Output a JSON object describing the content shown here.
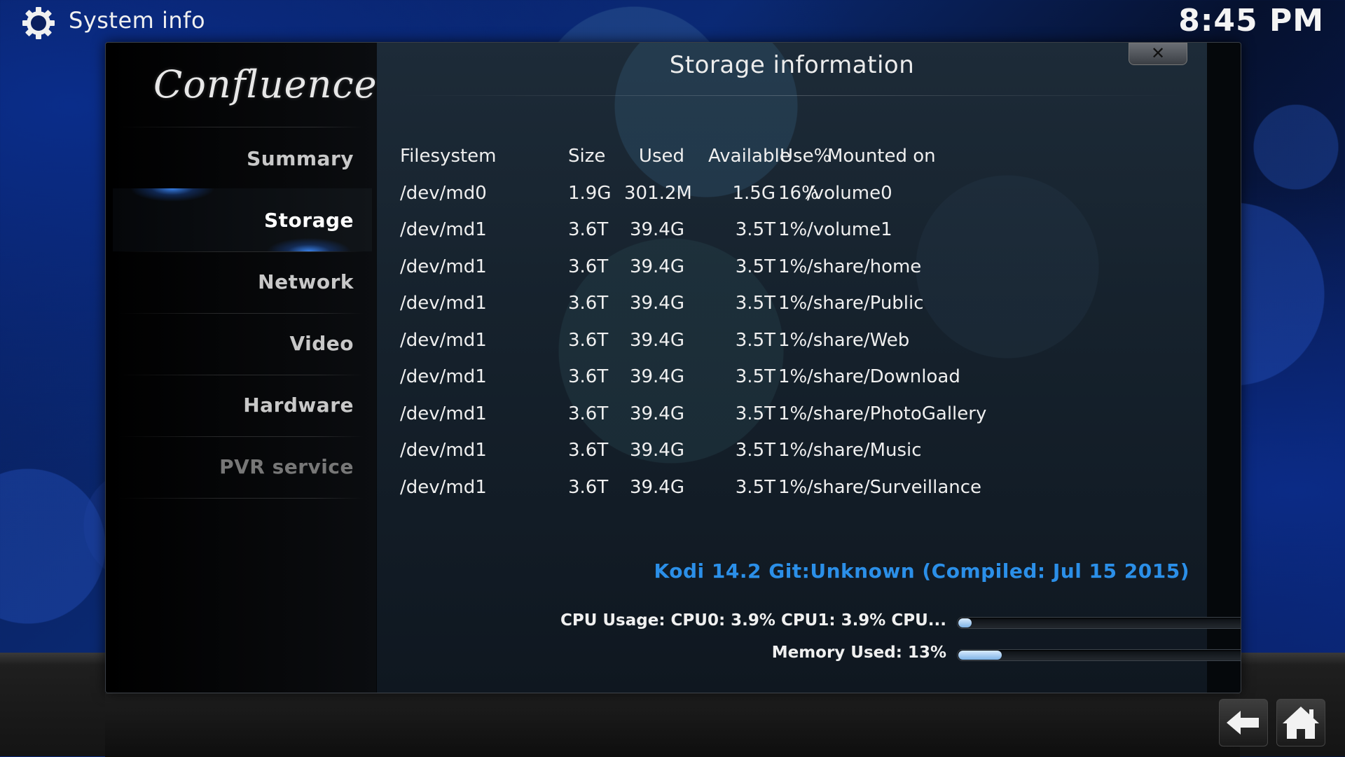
{
  "header": {
    "title": "System info",
    "clock": "8:45 PM"
  },
  "dialog": {
    "logo": "Confluence",
    "title": "Storage information",
    "close_label": "✕"
  },
  "sidebar": {
    "items": [
      {
        "label": "Summary"
      },
      {
        "label": "Storage"
      },
      {
        "label": "Network"
      },
      {
        "label": "Video"
      },
      {
        "label": "Hardware"
      },
      {
        "label": "PVR service"
      }
    ],
    "active": "Storage"
  },
  "storage_table": {
    "headers": [
      "Filesystem",
      "Size",
      "Used",
      "Available",
      "Use%",
      "Mounted on"
    ],
    "rows": [
      [
        "/dev/md0",
        "1.9G",
        "301.2M",
        "1.5G",
        "16%",
        "/volume0"
      ],
      [
        "/dev/md1",
        "3.6T",
        "39.4G",
        "3.5T",
        "1%",
        "/volume1"
      ],
      [
        "/dev/md1",
        "3.6T",
        "39.4G",
        "3.5T",
        "1%",
        "/share/home"
      ],
      [
        "/dev/md1",
        "3.6T",
        "39.4G",
        "3.5T",
        "1%",
        "/share/Public"
      ],
      [
        "/dev/md1",
        "3.6T",
        "39.4G",
        "3.5T",
        "1%",
        "/share/Web"
      ],
      [
        "/dev/md1",
        "3.6T",
        "39.4G",
        "3.5T",
        "1%",
        "/share/Download"
      ],
      [
        "/dev/md1",
        "3.6T",
        "39.4G",
        "3.5T",
        "1%",
        "/share/PhotoGallery"
      ],
      [
        "/dev/md1",
        "3.6T",
        "39.4G",
        "3.5T",
        "1%",
        "/share/Music"
      ],
      [
        "/dev/md1",
        "3.6T",
        "39.4G",
        "3.5T",
        "1%",
        "/share/Surveillance"
      ]
    ]
  },
  "version": "Kodi 14.2 Git:Unknown (Compiled: Jul 15 2015)",
  "stats": {
    "cpu_label": "CPU Usage: CPU0: 3.9% CPU1: 3.9% CPU...",
    "cpu_percent": 3.9,
    "memory_label": "Memory Used: 13%",
    "memory_percent": 13
  },
  "icons": {
    "header": "gear-icon",
    "back": "back-arrow-icon",
    "home": "home-icon"
  },
  "colors": {
    "accent": "#2b8fe8"
  }
}
